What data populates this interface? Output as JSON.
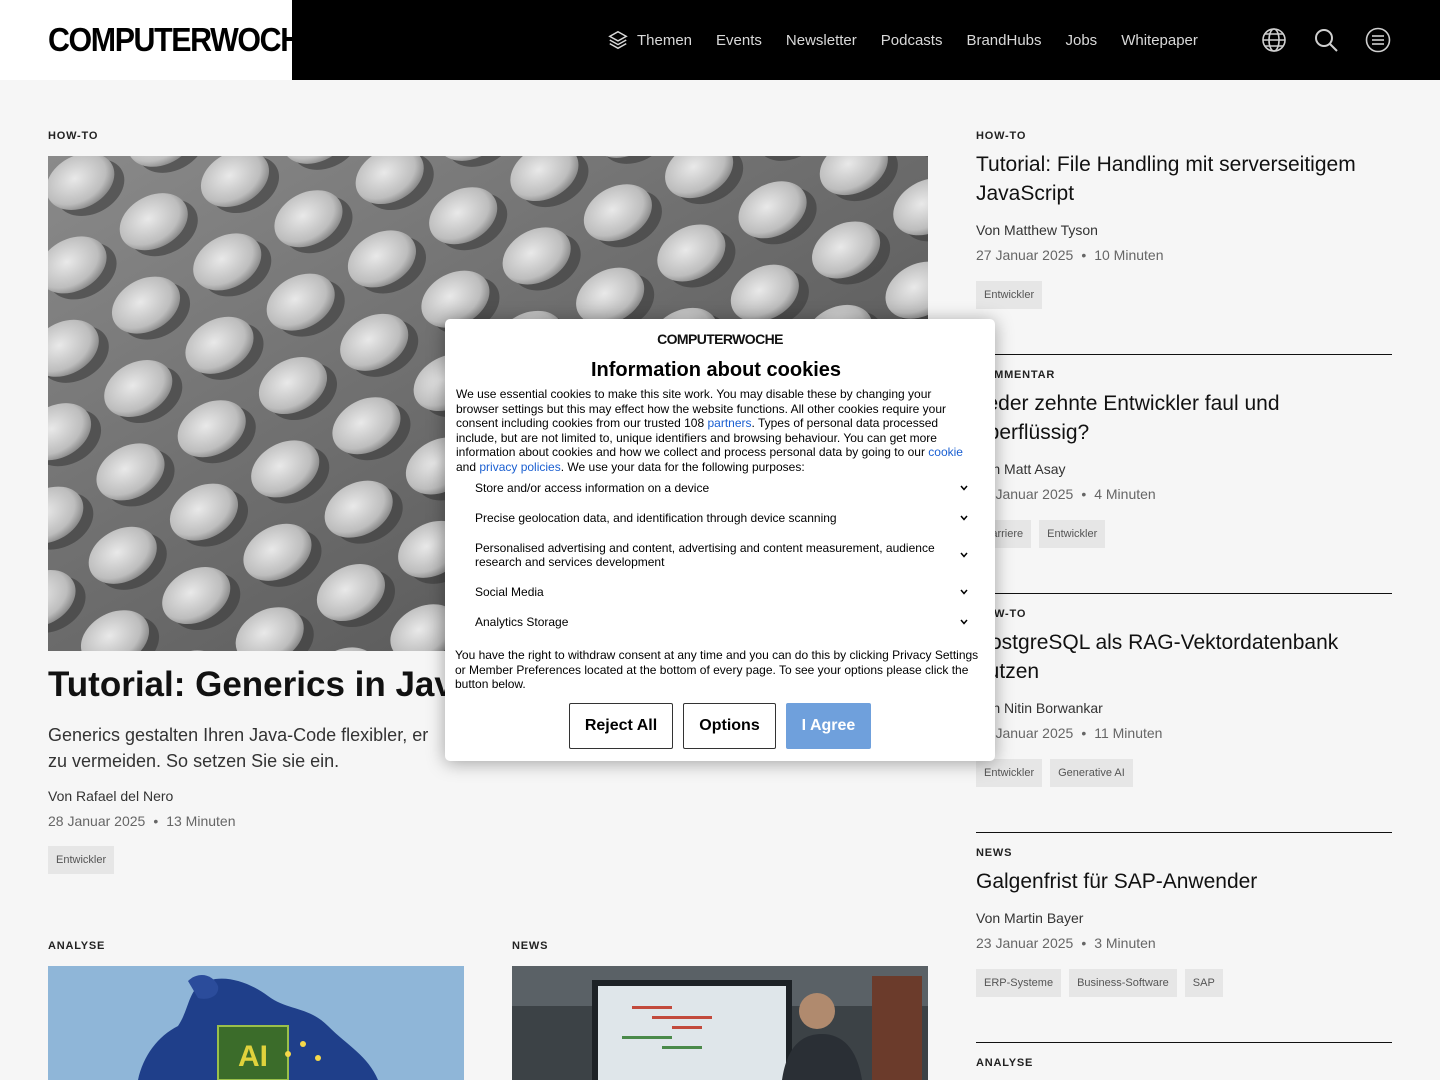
{
  "header": {
    "logo": "COMPUTERWOCHE",
    "nav": [
      "Themen",
      "Events",
      "Newsletter",
      "Podcasts",
      "BrandHubs",
      "Jobs",
      "Whitepaper"
    ],
    "icons": [
      "globe-icon",
      "search-icon",
      "menu-icon"
    ]
  },
  "hero": {
    "kicker": "HOW-TO",
    "title": "Tutorial: Generics in Java",
    "teaser_line1": "Generics gestalten Ihren Java-Code flexibler, er",
    "teaser_line2": "zu vermeiden. So setzen Sie sie ein.",
    "byline": "Von Rafael del Nero",
    "date": "28 Januar 2025",
    "read_time": "13 Minuten",
    "tags": [
      "Entwickler"
    ]
  },
  "cards": [
    {
      "kicker": "ANALYSE"
    },
    {
      "kicker": "NEWS"
    }
  ],
  "sidebar": [
    {
      "kicker": "HOW-TO",
      "title": "Tutorial: File Handling mit serverseitigem JavaScript",
      "byline": "Von Matthew Tyson",
      "date": "27 Januar 2025",
      "read_time": "10 Minuten",
      "tags": [
        "Entwickler"
      ]
    },
    {
      "kicker": "KOMMENTAR",
      "title": "Jeder zehnte Entwickler faul und überflüssig?",
      "byline": "Von Matt Asay",
      "date": "27 Januar 2025",
      "read_time": "4 Minuten",
      "tags": [
        "Karriere",
        "Entwickler"
      ]
    },
    {
      "kicker": "HOW-TO",
      "title": "PostgreSQL als RAG-Vektordatenbank nutzen",
      "byline": "Von Nitin Borwankar",
      "date": "24 Januar 2025",
      "read_time": "11 Minuten",
      "tags": [
        "Entwickler",
        "Generative AI"
      ]
    },
    {
      "kicker": "NEWS",
      "title": "Galgenfrist für SAP-Anwender",
      "byline": "Von Martin Bayer",
      "date": "23 Januar 2025",
      "read_time": "3 Minuten",
      "tags": [
        "ERP-Systeme",
        "Business-Software",
        "SAP"
      ]
    },
    {
      "kicker": "ANALYSE"
    }
  ],
  "cookie": {
    "logo": "COMPUTERWOCHE",
    "title": "Information about cookies",
    "text_a": "We use essential cookies to make this site work. You may disable these by changing your browser settings but this may effect how the website functions. All other cookies require your consent including cookies from our trusted 108 ",
    "link_partners": "partners",
    "text_b": ". Types of personal data processed include, but are not limited to, unique identifiers and browsing behaviour. You can get more information about cookies and how we collect and process personal data by going to our ",
    "link_cookie": "cookie",
    "text_c": " and ",
    "link_privacy": "privacy policies",
    "text_d": ". We use your data for the following purposes:",
    "purposes": [
      "Store and/or access information on a device",
      "Precise geolocation data, and identification through device scanning",
      "Personalised advertising and content, advertising and content measurement, audience research and services development",
      "Social Media",
      "Analytics Storage"
    ],
    "footer": "You have the right to withdraw consent at any time and you can do this by clicking Privacy Settings or Member Preferences located at the bottom of every page. To see your options please click the button below.",
    "reject": "Reject All",
    "options": "Options",
    "agree": "I Agree"
  },
  "colors": {
    "header_bg": "#000000",
    "agree_button": "#6fa0dc",
    "link": "#1a5fd1"
  }
}
